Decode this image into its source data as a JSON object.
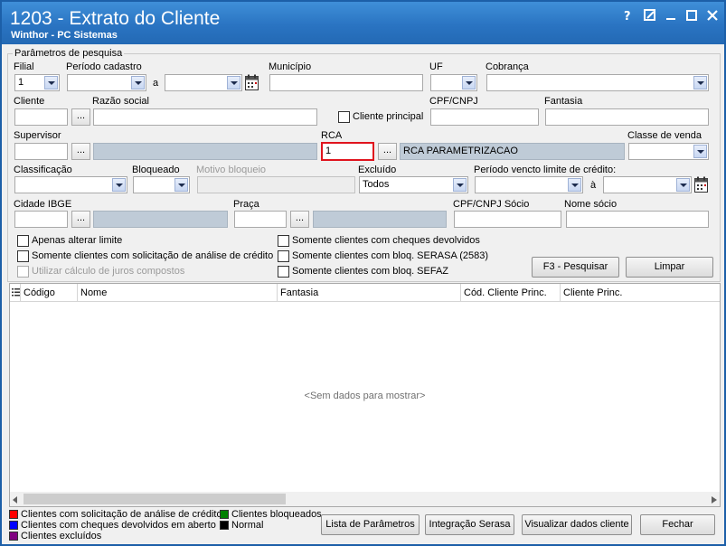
{
  "window": {
    "title": "1203 - Extrato do Cliente",
    "subtitle": "Winthor - PC Sistemas"
  },
  "params": {
    "group_label": "Parâmetros de pesquisa",
    "filial_label": "Filial",
    "filial_value": "1",
    "periodo_cadastro_label": "Período cadastro",
    "periodo_a_label": "a",
    "municipio_label": "Município",
    "uf_label": "UF",
    "cobranca_label": "Cobrança",
    "cliente_label": "Cliente",
    "razao_social_label": "Razão social",
    "cliente_principal_label": "Cliente principal",
    "cpf_cnpj_label": "CPF/CNPJ",
    "fantasia_label": "Fantasia",
    "supervisor_label": "Supervisor",
    "rca_label": "RCA",
    "rca_value": "1",
    "rca_name": "RCA PARAMETRIZACAO",
    "classe_venda_label": "Classe de venda",
    "classificacao_label": "Classificação",
    "bloqueado_label": "Bloqueado",
    "motivo_bloqueio_label": "Motivo bloqueio",
    "excluido_label": "Excluído",
    "excluido_value": "Todos",
    "periodo_vencto_label": "Período vencto limite de crédito:",
    "periodo_vencto_a_label": "à",
    "cidade_ibge_label": "Cidade IBGE",
    "praca_label": "Praça",
    "cpf_cnpj_socio_label": "CPF/CNPJ Sócio",
    "nome_socio_label": "Nome sócio",
    "ellipsis": "..."
  },
  "options": {
    "apenas_alterar_limite": "Apenas alterar limite",
    "somente_analise_credito": "Somente clientes com solicitação de análise de crédito",
    "utilizar_juros_compostos": "Utilizar cálculo de juros compostos",
    "somente_cheques_devolvidos": "Somente clientes com cheques devolvidos",
    "somente_bloq_serasa": "Somente clientes com bloq. SERASA (2583)",
    "somente_bloq_sefaz": "Somente clientes com bloq. SEFAZ"
  },
  "buttons": {
    "pesquisar": "F3 - Pesquisar",
    "limpar": "Limpar",
    "lista_parametros": "Lista de Parâmetros",
    "integracao_serasa": "Integração Serasa",
    "visualizar_dados": "Visualizar dados cliente",
    "fechar": "Fechar"
  },
  "grid": {
    "columns": [
      "Código",
      "Nome",
      "Fantasia",
      "Cód. Cliente Princ.",
      "Cliente Princ."
    ],
    "empty_text": "<Sem dados para mostrar>"
  },
  "legend": [
    {
      "label": "Clientes com solicitação de análise de crédito",
      "color": "#ff0000"
    },
    {
      "label": "Clientes com cheques devolvidos em aberto",
      "color": "#0000ff"
    },
    {
      "label": "Clientes excluídos",
      "color": "#800080"
    },
    {
      "label": "Clientes bloqueados",
      "color": "#008000"
    },
    {
      "label": "Normal",
      "color": "#000000"
    }
  ],
  "colors": {
    "titlebar": "#2a74c2",
    "readonly_field": "#bfcbd7",
    "rca_highlight": "#e0141e"
  }
}
